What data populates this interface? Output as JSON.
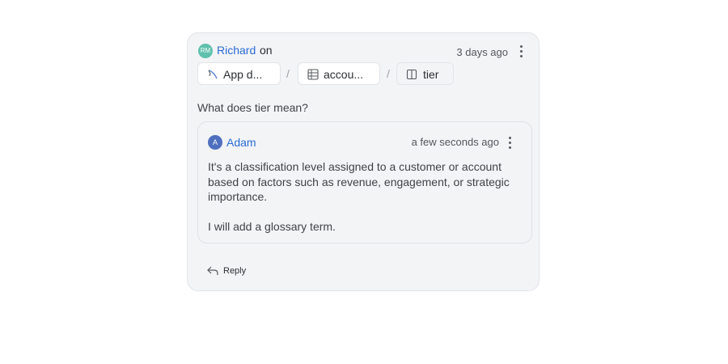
{
  "comment": {
    "avatar_initials": "RM",
    "author": "Richard",
    "on_text": "on",
    "time": "3 days ago",
    "breadcrumbs": [
      {
        "icon": "app-icon",
        "label": "App d..."
      },
      {
        "icon": "table-icon",
        "label": "accou..."
      },
      {
        "icon": "column-icon",
        "label": "tier"
      }
    ],
    "separator": "/",
    "question": "What does tier mean?"
  },
  "reply": {
    "avatar_initials": "A",
    "author": "Adam",
    "time": "a few seconds ago",
    "paragraphs": [
      "It's a classification level assigned to a customer or account based on factors such as revenue, engagement, or strategic importance.",
      "I will add a glossary term."
    ]
  },
  "actions": {
    "reply_label": "Reply",
    "reply_icon": "reply-arrow-icon",
    "more_icon": "more-vertical-icon"
  },
  "colors": {
    "accent_link": "#2a6bd6",
    "avatar_richard": "#5fc1ad",
    "avatar_adam": "#4f6fbf",
    "card_bg": "#f3f4f6"
  }
}
